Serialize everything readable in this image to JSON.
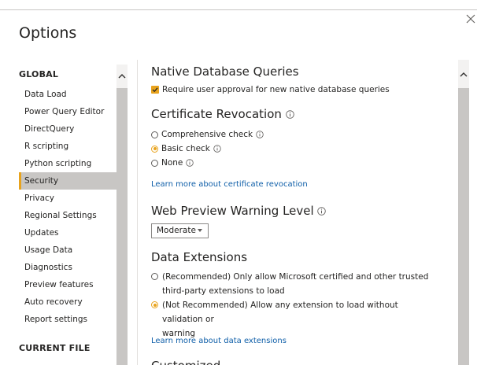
{
  "dialog": {
    "title": "Options"
  },
  "sidebar": {
    "global_header": "GLOBAL",
    "items": [
      {
        "label": "Data Load"
      },
      {
        "label": "Power Query Editor"
      },
      {
        "label": "DirectQuery"
      },
      {
        "label": "R scripting"
      },
      {
        "label": "Python scripting"
      },
      {
        "label": "Security",
        "active": true
      },
      {
        "label": "Privacy"
      },
      {
        "label": "Regional Settings"
      },
      {
        "label": "Updates"
      },
      {
        "label": "Usage Data"
      },
      {
        "label": "Diagnostics"
      },
      {
        "label": "Preview features"
      },
      {
        "label": "Auto recovery"
      },
      {
        "label": "Report settings"
      }
    ],
    "current_file_header": "CURRENT FILE"
  },
  "content": {
    "native_db": {
      "title": "Native Database Queries",
      "checkbox_label": "Require user approval for new native database queries",
      "checked": true
    },
    "cert_revocation": {
      "title": "Certificate Revocation",
      "options": [
        {
          "label": "Comprehensive check",
          "selected": false
        },
        {
          "label": "Basic check",
          "selected": true
        },
        {
          "label": "None",
          "selected": false
        }
      ],
      "link": "Learn more about certificate revocation"
    },
    "web_preview": {
      "title": "Web Preview Warning Level",
      "dropdown_value": "Moderate"
    },
    "data_extensions": {
      "title": "Data Extensions",
      "option1_line1": "(Recommended) Only allow Microsoft certified and other trusted",
      "option1_line2": "third-party extensions to load",
      "option1_selected": false,
      "option2_line1": "(Not Recommended) Allow any extension to load without validation or",
      "option2_line2": "warning",
      "option2_selected": true,
      "link": "Learn more about data extensions"
    },
    "next_section_partial": "Customized"
  },
  "colors": {
    "accent": "#e8a31d",
    "link": "#0e5ea8",
    "active_bg": "#c8c6c4"
  },
  "icons": {
    "close": "close-icon",
    "info": "info-icon",
    "scroll_up": "chevron-up-icon",
    "dropdown": "chevron-down-icon",
    "check": "checkmark-icon"
  }
}
